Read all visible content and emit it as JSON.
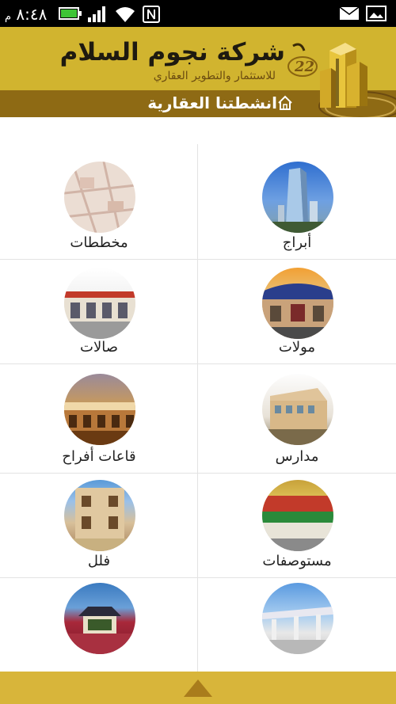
{
  "status": {
    "time": "٨:٤٨",
    "period": "م"
  },
  "header": {
    "title": "شركة نجوم السلام",
    "subtitle": "للاستثمار والتطوير العقاري",
    "section_title": "انشطتنا العقارية",
    "logo_number": "22"
  },
  "items": [
    {
      "label": "أبراج",
      "image": "towers"
    },
    {
      "label": "مخططات",
      "image": "plans"
    },
    {
      "label": "مولات",
      "image": "malls"
    },
    {
      "label": "صالات",
      "image": "halls"
    },
    {
      "label": "مدارس",
      "image": "schools"
    },
    {
      "label": "قاعات أفراح",
      "image": "wedding-halls"
    },
    {
      "label": "مستوصفات",
      "image": "clinics"
    },
    {
      "label": "فلل",
      "image": "villas"
    },
    {
      "label": "",
      "image": "stations"
    },
    {
      "label": "",
      "image": "resorts"
    }
  ],
  "colors": {
    "header_gold": "#d1b42f",
    "header_brown": "#8e6a14",
    "footer_gold": "#d8b53a"
  }
}
